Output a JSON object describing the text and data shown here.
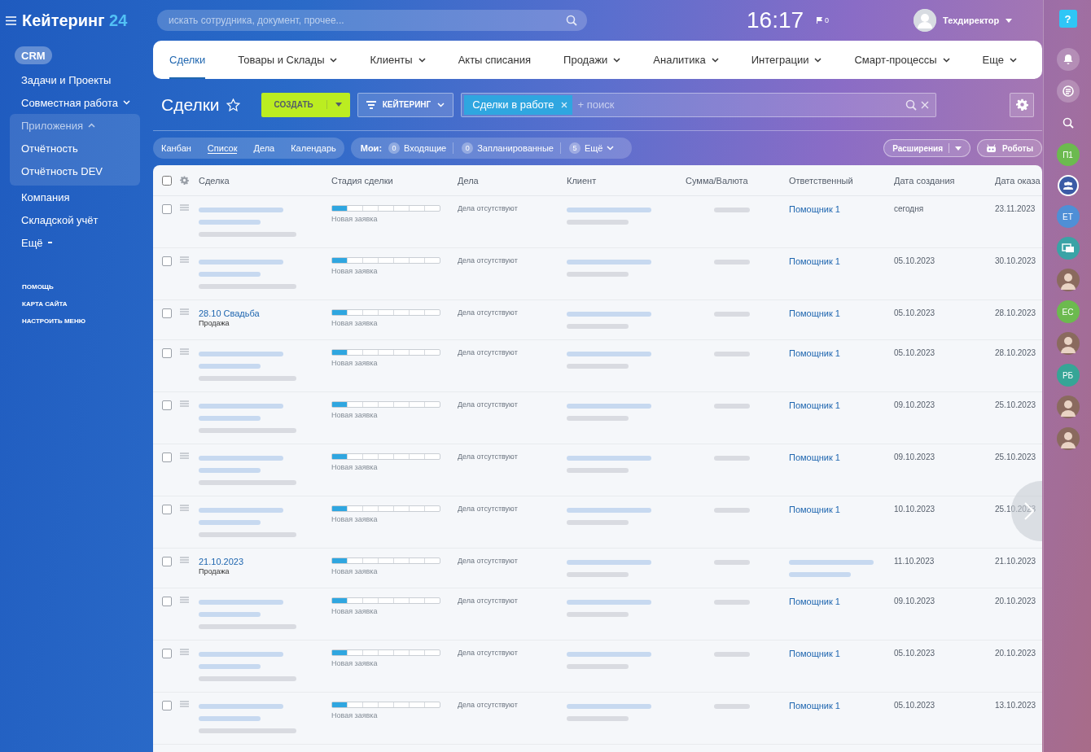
{
  "topbar": {
    "search_placeholder": "искать сотрудника, документ, прочее...",
    "time": "16:17",
    "flag_count": "0",
    "user": "Техдиректор"
  },
  "sidebar": {
    "logo": {
      "name": "Кейтеринг",
      "number": "24"
    },
    "items": [
      {
        "label": "CRM",
        "selected": true,
        "kind": "plain"
      },
      {
        "label": "Задачи и Проекты",
        "selected": false,
        "kind": "plain"
      },
      {
        "label": "Совместная работа",
        "selected": false,
        "kind": "menu"
      },
      {
        "label": "Приложения",
        "selected": false,
        "kind": "group",
        "expanded": true,
        "children": [
          {
            "label": "Отчётность",
            "selected": false
          },
          {
            "label": "Отчётность DEV",
            "selected": false
          }
        ]
      },
      {
        "label": "Компания",
        "selected": false,
        "kind": "plain"
      },
      {
        "label": "Складской учёт",
        "selected": false,
        "kind": "plain"
      },
      {
        "label": "Ещё",
        "selected": false,
        "kind": "more"
      }
    ],
    "links": [
      "ПОМОЩЬ",
      "КАРТА САЙТА",
      "НАСТРОИТЬ МЕНЮ"
    ]
  },
  "nav": {
    "tabs": [
      {
        "label": "Сделки",
        "selected": true,
        "has_menu": false
      },
      {
        "label": "Товары и Склады",
        "selected": false,
        "has_menu": true
      },
      {
        "label": "Клиенты",
        "selected": false,
        "has_menu": true
      },
      {
        "label": "Акты списания",
        "selected": false,
        "has_menu": false
      },
      {
        "label": "Продажи",
        "selected": false,
        "has_menu": true
      },
      {
        "label": "Аналитика",
        "selected": false,
        "has_menu": true
      },
      {
        "label": "Интеграции",
        "selected": false,
        "has_menu": true
      },
      {
        "label": "Смарт-процессы",
        "selected": false,
        "has_menu": true
      }
    ],
    "more": "Еще"
  },
  "toolbar": {
    "title": "Сделки",
    "create": "СОЗДАТЬ",
    "filter": "КЕЙТЕРИНГ",
    "filter_tag": "Сделки в работе",
    "search_placeholder": "+ поиск"
  },
  "views": [
    {
      "label": "Канбан",
      "selected": false
    },
    {
      "label": "Список",
      "selected": true
    },
    {
      "label": "Дела",
      "selected": false
    },
    {
      "label": "Календарь",
      "selected": false
    }
  ],
  "counters": {
    "label": "Мои:",
    "items": [
      {
        "count": "0",
        "label": "Входящие",
        "has_menu": false
      },
      {
        "count": "0",
        "label": "Запланированные",
        "has_menu": false
      },
      {
        "count": "5",
        "label": "Ещё",
        "has_menu": true
      }
    ]
  },
  "actions": [
    {
      "label": "Расширения",
      "kind": "split"
    },
    {
      "label": "Роботы",
      "kind": "robot"
    }
  ],
  "table": {
    "all_checked": false,
    "columns": [
      "Сделка",
      "Стадия сделки",
      "Дела",
      "Клиент",
      "Сумма/Валюта",
      "Ответственный",
      "Дата создания",
      "Дата оказа"
    ],
    "rows": [
      {
        "checked": false,
        "deal": {
          "redacted": true
        },
        "stage": {
          "level": 0.14,
          "label": "Новая заявка"
        },
        "activities": "Дела отсутствуют",
        "client": {
          "redacted": true
        },
        "sum": {
          "redacted": true
        },
        "responsible": {
          "lines": [
            {
              "text": "Помощник 1",
              "kind": "link"
            }
          ]
        },
        "created": "сегодня",
        "due": "23.11.2023"
      },
      {
        "checked": false,
        "deal": {
          "redacted": true
        },
        "stage": {
          "level": 0.14,
          "label": "Новая заявка"
        },
        "activities": "Дела отсутствуют",
        "client": {
          "redacted": true
        },
        "sum": {
          "redacted": true
        },
        "responsible": {
          "lines": [
            {
              "text": "Помощник 1",
              "kind": "link"
            }
          ]
        },
        "created": "05.10.2023",
        "due": "30.10.2023"
      },
      {
        "checked": false,
        "deal": {
          "lines": [
            {
              "text": "28.10 Свадьба",
              "kind": "link"
            },
            {
              "text": "Продажа",
              "kind": "text"
            }
          ]
        },
        "stage": {
          "level": 0.14,
          "label": "Новая заявка"
        },
        "activities": "Дела отсутствуют",
        "client": {
          "redacted": true
        },
        "sum": {
          "redacted": true
        },
        "responsible": {
          "lines": [
            {
              "text": "Помощник 1",
              "kind": "link"
            }
          ]
        },
        "created": "05.10.2023",
        "due": "28.10.2023"
      },
      {
        "checked": false,
        "deal": {
          "redacted": true
        },
        "stage": {
          "level": 0.14,
          "label": "Новая заявка"
        },
        "activities": "Дела отсутствуют",
        "client": {
          "redacted": true
        },
        "sum": {
          "redacted": true
        },
        "responsible": {
          "lines": [
            {
              "text": "Помощник 1",
              "kind": "link"
            }
          ]
        },
        "created": "05.10.2023",
        "due": "28.10.2023"
      },
      {
        "checked": false,
        "deal": {
          "redacted": true
        },
        "stage": {
          "level": 0.14,
          "label": "Новая заявка"
        },
        "activities": "Дела отсутствуют",
        "client": {
          "redacted": true
        },
        "sum": {
          "redacted": true
        },
        "responsible": {
          "lines": [
            {
              "text": "Помощник 1",
              "kind": "link"
            }
          ]
        },
        "created": "09.10.2023",
        "due": "25.10.2023"
      },
      {
        "checked": false,
        "deal": {
          "redacted": true
        },
        "stage": {
          "level": 0.14,
          "label": "Новая заявка"
        },
        "activities": "Дела отсутствуют",
        "client": {
          "redacted": true
        },
        "sum": {
          "redacted": true
        },
        "responsible": {
          "lines": [
            {
              "text": "Помощник 1",
              "kind": "link"
            }
          ]
        },
        "created": "09.10.2023",
        "due": "25.10.2023"
      },
      {
        "checked": false,
        "deal": {
          "redacted": true
        },
        "stage": {
          "level": 0.14,
          "label": "Новая заявка"
        },
        "activities": "Дела отсутствуют",
        "client": {
          "redacted": true
        },
        "sum": {
          "redacted": true
        },
        "responsible": {
          "lines": [
            {
              "text": "Помощник 1",
              "kind": "link"
            }
          ]
        },
        "created": "10.10.2023",
        "due": "25.10.2023"
      },
      {
        "checked": false,
        "deal": {
          "lines": [
            {
              "text": "21.10.2023",
              "kind": "link"
            },
            {
              "text": "Продажа",
              "kind": "text"
            }
          ]
        },
        "stage": {
          "level": 0.14,
          "label": "Новая заявка"
        },
        "activities": "Дела отсутствуют",
        "client": {
          "redacted": true
        },
        "sum": {
          "redacted": true
        },
        "responsible": {
          "redacted": true
        },
        "created": "11.10.2023",
        "due": "21.10.2023"
      },
      {
        "checked": false,
        "deal": {
          "redacted": true
        },
        "stage": {
          "level": 0.14,
          "label": "Новая заявка"
        },
        "activities": "Дела отсутствуют",
        "client": {
          "redacted": true
        },
        "sum": {
          "redacted": true
        },
        "responsible": {
          "lines": [
            {
              "text": "Помощник 1",
              "kind": "link"
            }
          ]
        },
        "created": "09.10.2023",
        "due": "20.10.2023"
      },
      {
        "checked": false,
        "deal": {
          "redacted": true
        },
        "stage": {
          "level": 0.14,
          "label": "Новая заявка"
        },
        "activities": "Дела отсутствуют",
        "client": {
          "redacted": true
        },
        "sum": {
          "redacted": true
        },
        "responsible": {
          "lines": [
            {
              "text": "Помощник 1",
              "kind": "link"
            }
          ]
        },
        "created": "05.10.2023",
        "due": "20.10.2023"
      },
      {
        "checked": false,
        "deal": {
          "redacted": true
        },
        "stage": {
          "level": 0.14,
          "label": "Новая заявка"
        },
        "activities": "Дела отсутствуют",
        "client": {
          "redacted": true
        },
        "sum": {
          "redacted": true
        },
        "responsible": {
          "lines": [
            {
              "text": "Помощник 1",
              "kind": "link"
            }
          ]
        },
        "created": "05.10.2023",
        "due": "13.10.2023"
      }
    ]
  },
  "rightbar": {
    "help": "?",
    "items": [
      {
        "kind": "bell"
      },
      {
        "kind": "chat"
      },
      {
        "kind": "search"
      },
      {
        "kind": "initials",
        "text": "П1",
        "color": "#6cba4f"
      },
      {
        "kind": "group",
        "color": "#3b5ba6"
      },
      {
        "kind": "initials",
        "text": "ЕТ",
        "color": "#4f8fd6"
      },
      {
        "kind": "gallery",
        "color": "#3aa3a6"
      },
      {
        "kind": "photo"
      },
      {
        "kind": "initials",
        "text": "ЕС",
        "color": "#6cba4f"
      },
      {
        "kind": "photo"
      },
      {
        "kind": "initials",
        "text": "РБ",
        "color": "#36a596"
      },
      {
        "kind": "photo"
      },
      {
        "kind": "photo"
      }
    ]
  }
}
